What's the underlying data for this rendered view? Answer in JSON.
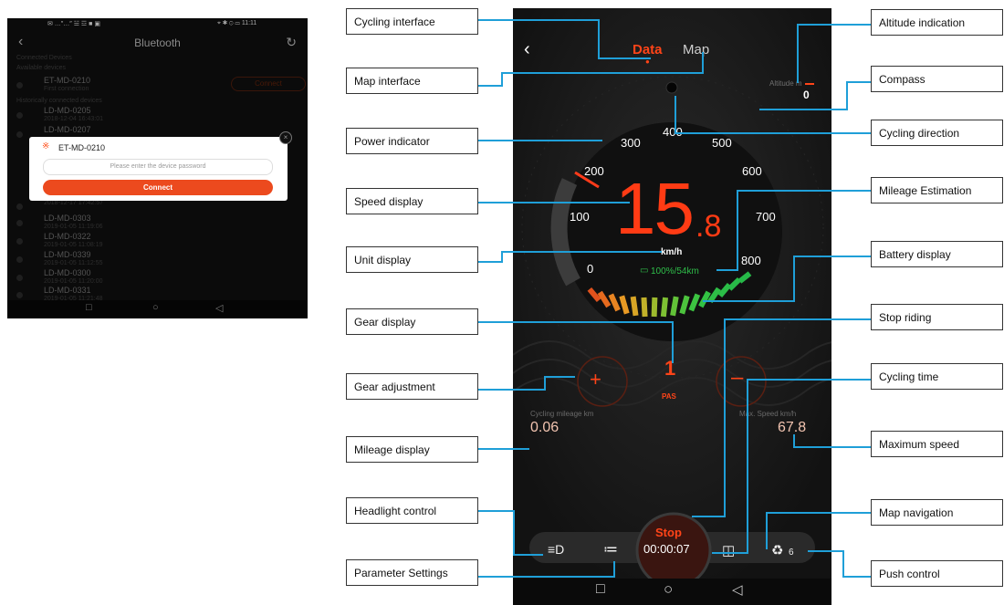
{
  "left_screen": {
    "status": {
      "left": "✉ …″…″ ☱ ☲ ■ ▣",
      "right": "⌖ ✱ ⊙ ▭ 11:11"
    },
    "title": "Bluetooth",
    "section_connected": "Connected Devices",
    "section_available": "Available devices",
    "available_device": {
      "name": "ET-MD-0210",
      "sub": "First connection",
      "button": "Connect"
    },
    "section_history": "Historically connected devices",
    "history": [
      {
        "name": "LD-MD-0205",
        "sub": "2018-12-04 16:43:01"
      },
      {
        "name": "LD-MD-0207",
        "sub": ""
      },
      {
        "name": "",
        "sub": "2018-12-17 17:42:57"
      },
      {
        "name": "LD-MD-0303",
        "sub": "2019-01-05 11:19:06"
      },
      {
        "name": "LD-MD-0322",
        "sub": "2019-01-05 11:08:19"
      },
      {
        "name": "LD-MD-0339",
        "sub": "2019-01-05 11:12:55"
      },
      {
        "name": "LD-MD-0300",
        "sub": "2019-01-05 11:20:00"
      },
      {
        "name": "LD-MD-0331",
        "sub": "2019-01-05 11:21:48"
      }
    ],
    "dialog": {
      "device": "ET-MD-0210",
      "password_placeholder": "Please enter the device password",
      "connect_label": "Connect"
    }
  },
  "cycling_screen": {
    "tabs": {
      "data": "Data",
      "map": "Map"
    },
    "altitude_label": "Altitude m",
    "altitude_value": "0",
    "power_ticks": [
      "0",
      "100",
      "200",
      "300",
      "400",
      "500",
      "600",
      "700",
      "800"
    ],
    "speed_int": "15",
    "speed_dec": ".8",
    "speed_unit": "km/h",
    "battery_text": "100%/54km",
    "gear_value": "1",
    "gear_mode": "PAS",
    "mileage_label": "Cycling mileage km",
    "mileage_value": "0.06",
    "max_speed_label": "Max. Speed km/h",
    "max_speed_value": "67.8",
    "stop_label": "Stop",
    "time_value": "00:00:07",
    "push_value": "6",
    "colors": {
      "accent": "#ff4418",
      "battery": "#2fbf4a",
      "background": "#151515"
    }
  },
  "annotations": {
    "left": [
      "Cycling interface",
      "Map interface",
      "Power indicator",
      "Speed display",
      "Unit display",
      "Gear display",
      "Gear adjustment",
      "Mileage display",
      "Headlight control",
      "Parameter Settings"
    ],
    "right": [
      "Altitude indication",
      "Compass",
      "Cycling direction",
      "Mileage Estimation",
      "Battery display",
      "Stop riding",
      "Cycling time",
      "Maximum speed",
      "Map navigation",
      "Push control"
    ]
  }
}
